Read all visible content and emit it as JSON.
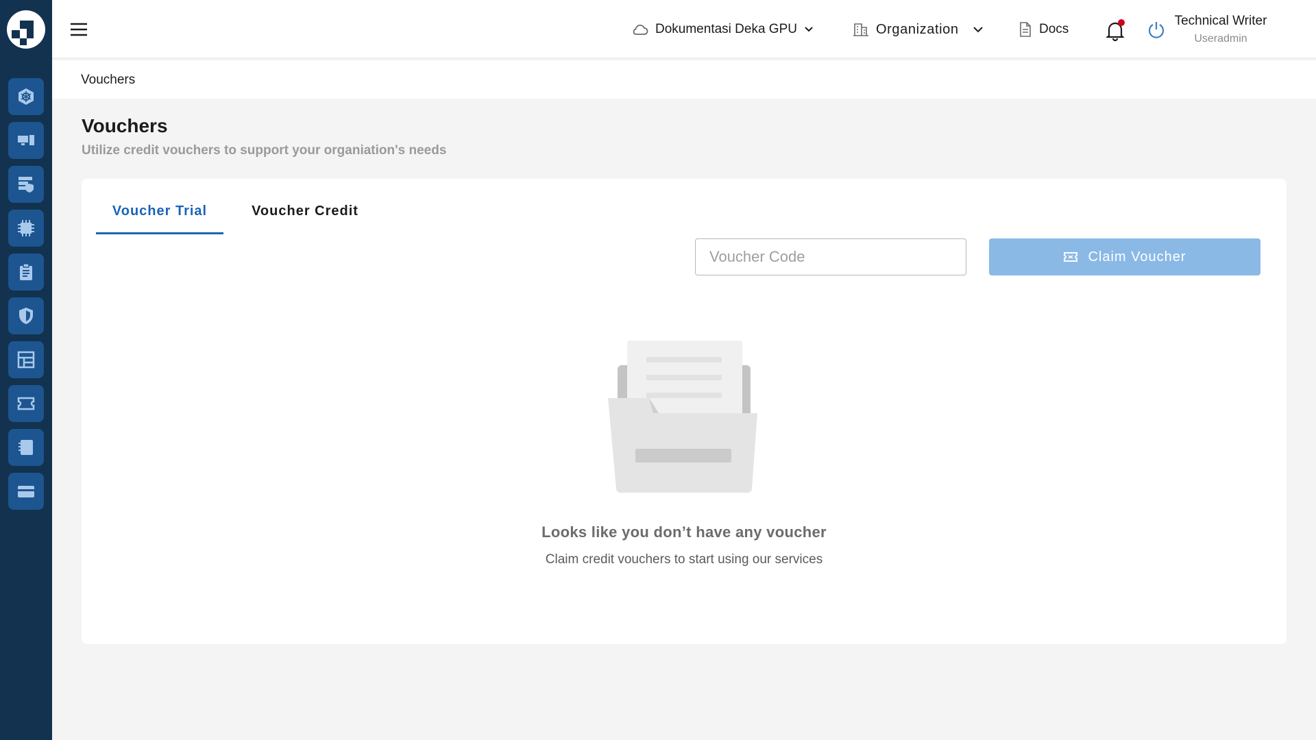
{
  "header": {
    "project": "Dokumentasi Deka GPU",
    "organization": "Organization",
    "docs": "Docs",
    "user_name": "Technical Writer",
    "user_role": "Useradmin"
  },
  "breadcrumb": "Vouchers",
  "page": {
    "title": "Vouchers",
    "subtitle": "Utilize credit vouchers to support your organiation's needs"
  },
  "tabs": [
    {
      "label": "Voucher Trial",
      "active": true
    },
    {
      "label": "Voucher Credit",
      "active": false
    }
  ],
  "voucher_input": {
    "placeholder": "Voucher Code",
    "value": ""
  },
  "claim_button": "Claim Voucher",
  "empty_state": {
    "title": "Looks like you don’t have any voucher",
    "subtitle": "Claim credit vouchers to start using our services"
  },
  "sidebar": {
    "items": [
      {
        "icon": "kubernetes-icon"
      },
      {
        "icon": "desktop-icon"
      },
      {
        "icon": "storage-shield-icon"
      },
      {
        "icon": "cpu-chip-icon"
      },
      {
        "icon": "clipboard-icon"
      },
      {
        "icon": "shield-icon"
      },
      {
        "icon": "dashboard-layout-icon"
      },
      {
        "icon": "ticket-icon"
      },
      {
        "icon": "notebook-icon"
      },
      {
        "icon": "credit-card-icon"
      }
    ]
  },
  "colors": {
    "sidebar_bg": "#12324f",
    "sidebar_button": "#1d5590",
    "accent": "#1a63b8",
    "claim_button_bg": "#8ab9e6",
    "notification_dot": "#d0021b"
  }
}
